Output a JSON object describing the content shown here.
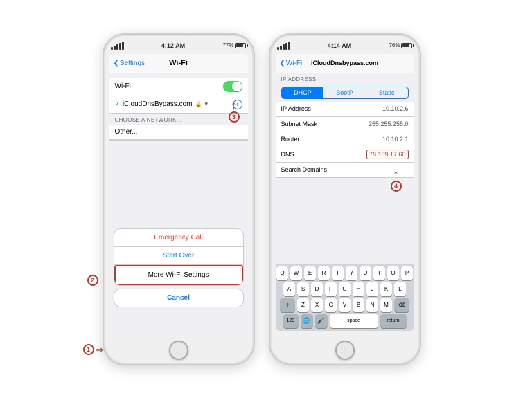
{
  "left_phone": {
    "status_bar": {
      "signal_dots": "•••••",
      "wifi": "▾",
      "time": "4:12 AM",
      "battery_pct": "77%"
    },
    "nav": {
      "back": "Settings",
      "title": "Wi-Fi"
    },
    "wifi_toggle_label": "Wi-Fi",
    "network": "iCloudDnsBypass.com",
    "choose_header": "CHOOSE A NETWORK...",
    "other_label": "Other...",
    "action_sheet": {
      "emergency": "Emergency Call",
      "start_over": "Start Over",
      "more_wifi": "More Wi-Fi Settings",
      "cancel": "Cancel"
    },
    "annotations": {
      "n1": "1",
      "n2": "2",
      "n3": "3"
    }
  },
  "right_phone": {
    "status_bar": {
      "time": "4:14 AM",
      "battery_pct": "76%"
    },
    "nav": {
      "back": "Wi-Fi",
      "title": "iCloudDnsbypass.com"
    },
    "ip_section": "IP ADDRESS",
    "segments": [
      "DHCP",
      "BootP",
      "Static"
    ],
    "active_segment": "DHCP",
    "rows": [
      {
        "label": "IP Address",
        "value": "10.10.2.6"
      },
      {
        "label": "Subnet Mask",
        "value": "255.255.255.0"
      },
      {
        "label": "Router",
        "value": "10.10.2.1"
      },
      {
        "label": "DNS",
        "value": "78.109.17.60"
      },
      {
        "label": "Search Domains",
        "value": ""
      }
    ],
    "keyboard": {
      "row1": [
        "Q",
        "W",
        "E",
        "R",
        "T",
        "Y",
        "U",
        "I",
        "O",
        "P"
      ],
      "row2": [
        "A",
        "S",
        "D",
        "F",
        "G",
        "H",
        "J",
        "K",
        "L"
      ],
      "row3": [
        "Z",
        "X",
        "C",
        "V",
        "B",
        "N",
        "M"
      ],
      "bottom": [
        "123",
        "🌐",
        "🎤",
        "space",
        "return"
      ]
    },
    "annotations": {
      "n4": "4"
    }
  }
}
